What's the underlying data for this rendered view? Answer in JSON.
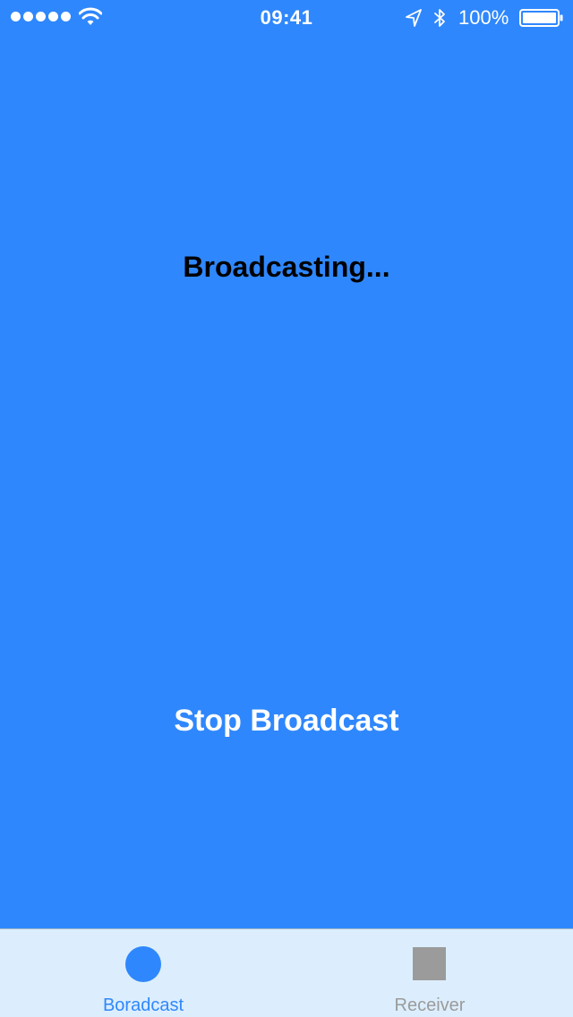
{
  "status_bar": {
    "time": "09:41",
    "battery_percent": "100%",
    "signal_bars": 5,
    "icons": [
      "signal-dots-icon",
      "wifi-icon",
      "location-arrow-icon",
      "bluetooth-icon",
      "battery-icon"
    ]
  },
  "main": {
    "status_text": "Broadcasting...",
    "stop_button_label": "Stop Broadcast"
  },
  "tab_bar": {
    "tabs": [
      {
        "label": "Boradcast",
        "icon": "circle-icon",
        "selected": true
      },
      {
        "label": "Receiver",
        "icon": "square-icon",
        "selected": false
      }
    ]
  },
  "colors": {
    "background": "#2f87fd",
    "tab_bar_background": "#dceefd",
    "selected_tab": "#2f87fd",
    "unselected_tab": "#9b9b9b"
  }
}
